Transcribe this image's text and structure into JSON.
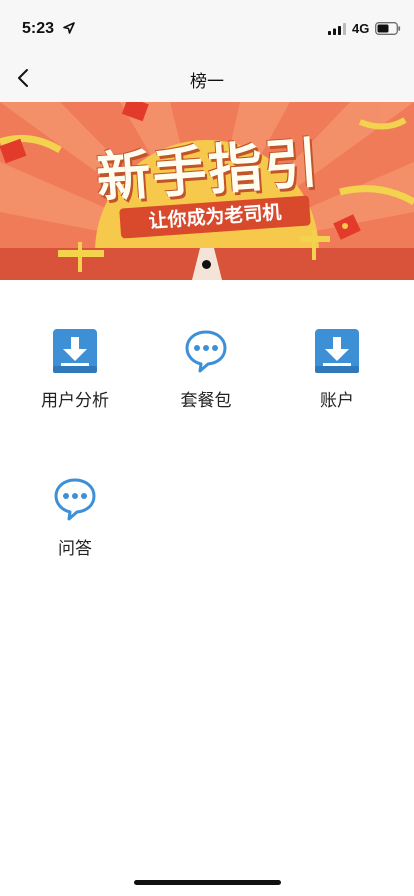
{
  "status_bar": {
    "time": "5:23",
    "network": "4G"
  },
  "nav": {
    "title": "榜一"
  },
  "banner": {
    "title": "新手指引",
    "subtitle": "让你成为老司机"
  },
  "menu": [
    {
      "label": "用户分析",
      "icon": "download-icon"
    },
    {
      "label": "套餐包",
      "icon": "chat-bubble-icon"
    },
    {
      "label": "账户",
      "icon": "download-icon"
    },
    {
      "label": "问答",
      "icon": "chat-bubble-icon"
    }
  ],
  "colors": {
    "icon_blue": "#3d8fd6",
    "banner_orange": "#f07b58",
    "banner_sun": "#f6c94c",
    "banner_red": "#d94a2c"
  }
}
